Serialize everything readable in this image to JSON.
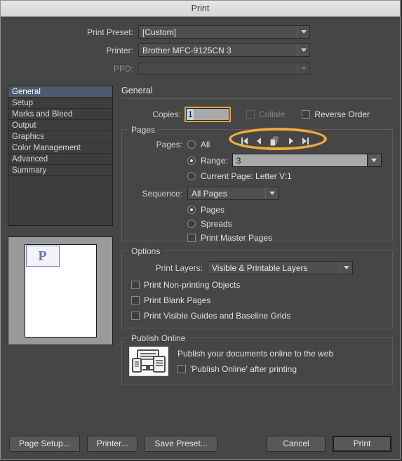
{
  "window": {
    "title": "Print"
  },
  "top_form": {
    "print_preset": {
      "label": "Print Preset:",
      "value": "[Custom]"
    },
    "printer": {
      "label": "Printer:",
      "value": "Brother MFC-9125CN 3"
    },
    "ppd": {
      "label": "PPD:",
      "value": ""
    }
  },
  "sidebar": {
    "items": [
      {
        "label": "General",
        "selected": true
      },
      {
        "label": "Setup",
        "selected": false
      },
      {
        "label": "Marks and Bleed",
        "selected": false
      },
      {
        "label": "Output",
        "selected": false
      },
      {
        "label": "Graphics",
        "selected": false
      },
      {
        "label": "Color Management",
        "selected": false
      },
      {
        "label": "Advanced",
        "selected": false
      },
      {
        "label": "Summary",
        "selected": false
      }
    ]
  },
  "preview": {
    "page_letter": "P"
  },
  "main": {
    "section_title": "General",
    "copies": {
      "label": "Copies:",
      "value": "1"
    },
    "collate": {
      "label": "Collate",
      "checked": false,
      "enabled": false
    },
    "reverse_order": {
      "label": "Reverse Order",
      "checked": false,
      "enabled": true
    },
    "pages_group": {
      "legend": "Pages",
      "pages_label": "Pages:",
      "all": {
        "label": "All",
        "selected": false
      },
      "range": {
        "label": "Range:",
        "value": "3",
        "selected": true
      },
      "current_page": {
        "label": "Current Page: Letter V:1",
        "selected": false
      },
      "sequence": {
        "label": "Sequence:",
        "value": "All Pages"
      },
      "pages_radio": {
        "label": "Pages",
        "selected": true
      },
      "spreads_radio": {
        "label": "Spreads",
        "selected": false
      },
      "print_master_pages": {
        "label": "Print Master Pages",
        "checked": false
      },
      "page_nav": {
        "first": "first-page-icon",
        "previous": "previous-page-icon",
        "pages": "stacked-pages-icon",
        "next": "next-page-icon",
        "last": "last-page-icon",
        "highlight_color": "#f0a93c"
      }
    },
    "options_group": {
      "legend": "Options",
      "print_layers": {
        "label": "Print Layers:",
        "value": "Visible & Printable Layers"
      },
      "print_non_printing_objects": {
        "label": "Print Non-printing Objects",
        "checked": false
      },
      "print_blank_pages": {
        "label": "Print Blank Pages",
        "checked": false
      },
      "print_visible_guides": {
        "label": "Print Visible Guides and Baseline Grids",
        "checked": false
      }
    },
    "publish_group": {
      "legend": "Publish Online",
      "icon": "publish-online-devices-icon",
      "description": "Publish your documents online to the web",
      "after_printing": {
        "label": "'Publish Online' after printing",
        "checked": false
      }
    }
  },
  "footer": {
    "page_setup": "Page Setup...",
    "printer": "Printer...",
    "save_preset": "Save Preset...",
    "cancel": "Cancel",
    "print": "Print"
  }
}
